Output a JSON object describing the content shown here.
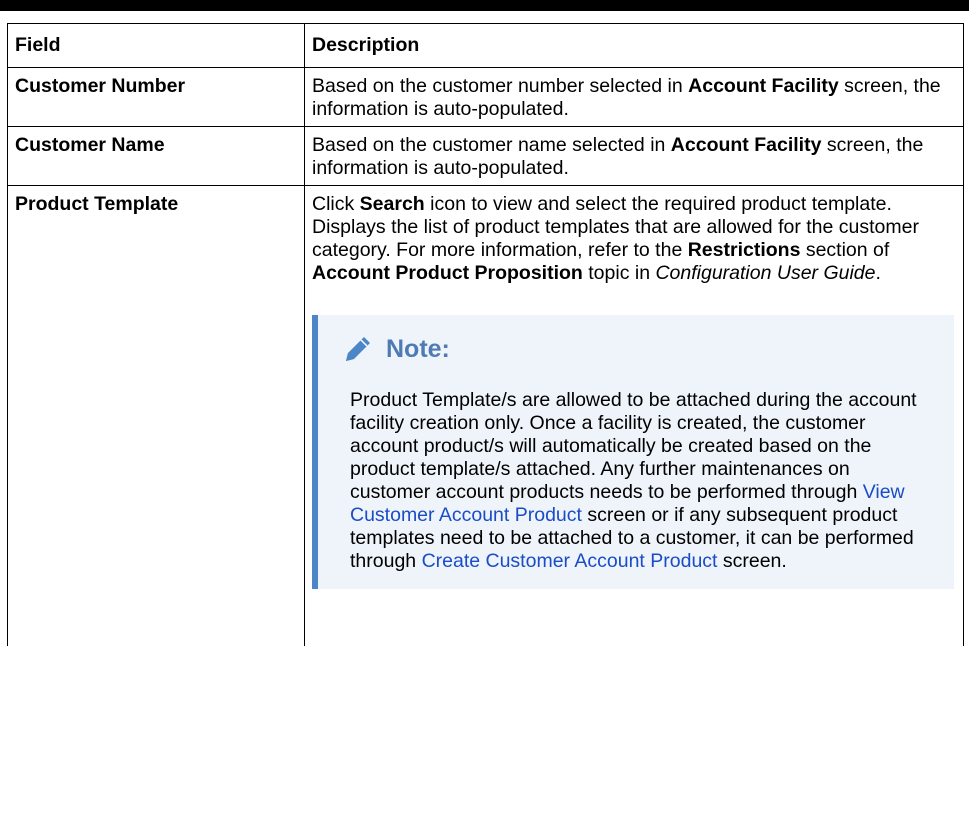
{
  "table": {
    "header": {
      "field": "Field",
      "description": "Description"
    },
    "rows": [
      {
        "field": "Customer Number",
        "desc_1": "Based on the customer number selected in ",
        "desc_bold": "Account Facility",
        "desc_2": " screen, the information is auto-populated."
      },
      {
        "field": "Customer Name",
        "desc_1": "Based on the customer name selected in ",
        "desc_bold": "Account Facility",
        "desc_2": " screen, the information is auto-populated."
      },
      {
        "field": "Product Template",
        "desc_1": "Click ",
        "desc_bold_1": "Search",
        "desc_2": " icon to view and select the required product template. Displays the list of product templates that are allowed for the customer category. For more information, refer to the ",
        "desc_bold_2": "Restrictions",
        "desc_3": " section of ",
        "desc_bold_3": "Account Product Proposition",
        "desc_4": " topic in ",
        "desc_italic": "Configuration User Guide",
        "desc_5": ".",
        "note": {
          "icon": "pencil-icon",
          "title": "Note:",
          "text_1": "Product Template/s are allowed to be attached during the account facility creation only. Once a facility is created, the customer account product/s will automatically be created based on the product template/s attached. Any further maintenances on customer account products needs to be performed through ",
          "link_1": "View Customer Account Product",
          "text_2": " screen or if any subsequent product templates need to be attached to a customer, it can be performed through ",
          "link_2": "Create Customer Account Product",
          "text_3": " screen."
        }
      }
    ]
  },
  "colors": {
    "text": "#000000",
    "link": "#1a4cc8",
    "note_title": "#4f7bb4",
    "note_border": "#4d86c6",
    "note_background": "#eef4fa"
  }
}
